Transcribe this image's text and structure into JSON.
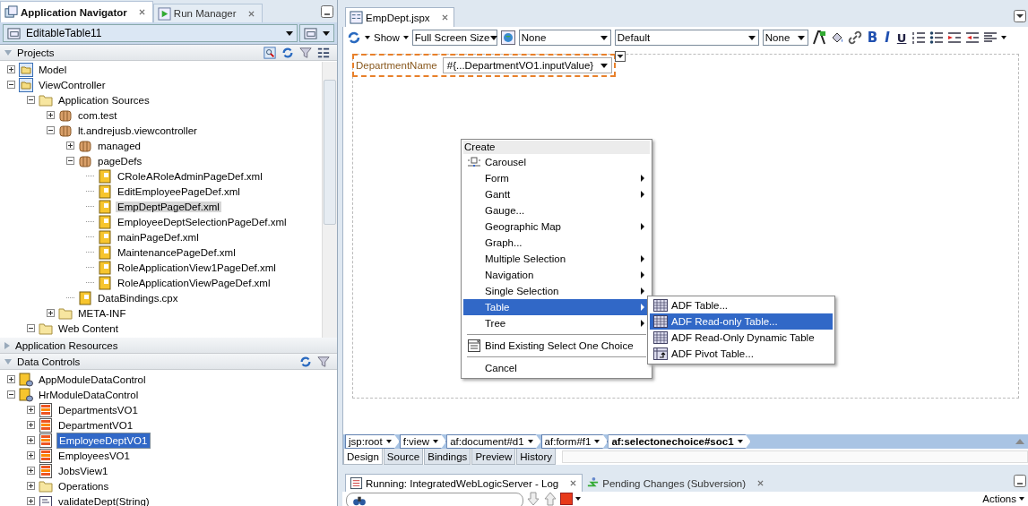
{
  "navigator": {
    "tabs": [
      {
        "label": "Application Navigator",
        "selected": true
      },
      {
        "label": "Run Manager",
        "selected": false
      }
    ],
    "application": "EditableTable11",
    "projects": {
      "title": "Projects",
      "expanded": true,
      "focused": false,
      "tree": [
        {
          "label": "Model",
          "kind": "project",
          "expanded": false,
          "selected": false
        },
        {
          "label": "ViewController",
          "kind": "project",
          "expanded": true,
          "selected": false,
          "children": [
            {
              "label": "Application Sources",
              "kind": "folder",
              "expanded": true,
              "selected": false,
              "children": [
                {
                  "label": "com.test",
                  "kind": "package",
                  "expanded": false,
                  "selected": false
                },
                {
                  "label": "lt.andrejusb.viewcontroller",
                  "kind": "package",
                  "expanded": true,
                  "selected": false,
                  "children": [
                    {
                      "label": "managed",
                      "kind": "package",
                      "expanded": false,
                      "selected": false
                    },
                    {
                      "label": "pageDefs",
                      "kind": "package",
                      "expanded": true,
                      "selected": false,
                      "children": [
                        {
                          "label": "CRoleARoleAdminPageDef.xml",
                          "kind": "pagedef",
                          "selected": false
                        },
                        {
                          "label": "EditEmployeePageDef.xml",
                          "kind": "pagedef",
                          "selected": false
                        },
                        {
                          "label": "EmpDeptPageDef.xml",
                          "kind": "pagedef",
                          "selected": true
                        },
                        {
                          "label": "EmployeeDeptSelectionPageDef.xml",
                          "kind": "pagedef",
                          "selected": false
                        },
                        {
                          "label": "mainPageDef.xml",
                          "kind": "pagedef",
                          "selected": false
                        },
                        {
                          "label": "MaintenancePageDef.xml",
                          "kind": "pagedef",
                          "selected": false
                        },
                        {
                          "label": "RoleApplicationView1PageDef.xml",
                          "kind": "pagedef",
                          "selected": false
                        },
                        {
                          "label": "RoleApplicationViewPageDef.xml",
                          "kind": "pagedef",
                          "selected": false
                        }
                      ]
                    },
                    {
                      "label": "DataBindings.cpx",
                      "kind": "pagedef",
                      "selected": false
                    }
                  ]
                },
                {
                  "label": "META-INF",
                  "kind": "folder",
                  "expanded": false,
                  "selected": false
                }
              ]
            },
            {
              "label": "Web Content",
              "kind": "folder",
              "expanded": true,
              "selected": false
            }
          ]
        }
      ]
    },
    "resources": {
      "title": "Application Resources",
      "expanded": false
    },
    "data_controls": {
      "title": "Data Controls",
      "expanded": true,
      "focused": true,
      "tree": [
        {
          "label": "AppModuleDataControl",
          "kind": "datacontrol",
          "expanded": false,
          "selected": false
        },
        {
          "label": "HrModuleDataControl",
          "kind": "datacontrol",
          "expanded": true,
          "selected": false,
          "children": [
            {
              "label": "DepartmentsVO1",
              "kind": "collection",
              "expanded": false,
              "selected": false
            },
            {
              "label": "DepartmentVO1",
              "kind": "collection",
              "expanded": false,
              "selected": false
            },
            {
              "label": "EmployeeDeptVO1",
              "kind": "collection",
              "expanded": false,
              "selected": true
            },
            {
              "label": "EmployeesVO1",
              "kind": "collection",
              "expanded": false,
              "selected": false
            },
            {
              "label": "JobsView1",
              "kind": "collection",
              "expanded": false,
              "selected": false
            },
            {
              "label": "Operations",
              "kind": "folder",
              "expanded": false,
              "selected": false
            },
            {
              "label": "validateDept(String)",
              "kind": "method",
              "expanded": false,
              "selected": false
            }
          ]
        }
      ]
    }
  },
  "editor": {
    "tab": {
      "label": "EmpDept.jspx"
    },
    "toolbar": {
      "show": "Show",
      "size": "Full Screen Size",
      "selects": [
        "None",
        "Default",
        "None"
      ],
      "format_buttons": [
        "B",
        "I",
        "U"
      ]
    },
    "form": {
      "label": "DepartmentName",
      "value": "#{...DepartmentVO1.inputValue}"
    },
    "context_menu": {
      "title": "Create",
      "items": [
        {
          "kind": "carousel",
          "label": "Carousel",
          "submenu": false,
          "selected": false
        },
        {
          "kind": "plain",
          "label": "Form",
          "submenu": true,
          "selected": false
        },
        {
          "kind": "plain",
          "label": "Gantt",
          "submenu": true,
          "selected": false
        },
        {
          "kind": "plain",
          "label": "Gauge...",
          "submenu": false,
          "selected": false
        },
        {
          "kind": "plain",
          "label": "Geographic Map",
          "submenu": true,
          "selected": false
        },
        {
          "kind": "plain",
          "label": "Graph...",
          "submenu": false,
          "selected": false
        },
        {
          "kind": "plain",
          "label": "Multiple Selection",
          "submenu": true,
          "selected": false
        },
        {
          "kind": "plain",
          "label": "Navigation",
          "submenu": true,
          "selected": false
        },
        {
          "kind": "plain",
          "label": "Single Selection",
          "submenu": true,
          "selected": false
        },
        {
          "kind": "plain",
          "label": "Table",
          "submenu": true,
          "selected": true
        },
        {
          "kind": "plain",
          "label": "Tree",
          "submenu": true,
          "selected": false
        },
        {
          "kind": "separator"
        },
        {
          "kind": "binding",
          "label": "Bind Existing Select One Choice",
          "submenu": false,
          "selected": false
        },
        {
          "kind": "separator"
        },
        {
          "kind": "plain",
          "label": "Cancel",
          "submenu": false,
          "selected": false
        }
      ]
    },
    "submenu": {
      "items": [
        {
          "kind": "table",
          "label": "ADF Table...",
          "selected": false
        },
        {
          "kind": "table",
          "label": "ADF Read-only Table...",
          "selected": true
        },
        {
          "kind": "table",
          "label": "ADF Read-Only Dynamic Table",
          "selected": false
        },
        {
          "kind": "pivot",
          "label": "ADF Pivot Table...",
          "selected": false
        }
      ]
    },
    "breadcrumb": [
      {
        "label": "jsp:root",
        "selected": false
      },
      {
        "label": "f:view",
        "selected": false
      },
      {
        "label": "af:document#d1",
        "selected": false
      },
      {
        "label": "af:form#f1",
        "selected": false
      },
      {
        "label": "af:selectonechoice#soc1",
        "selected": true
      }
    ],
    "view_tabs": [
      {
        "label": "Design",
        "selected": true
      },
      {
        "label": "Source",
        "selected": false
      },
      {
        "label": "Bindings",
        "selected": false
      },
      {
        "label": "Preview",
        "selected": false
      },
      {
        "label": "History",
        "selected": false
      }
    ]
  },
  "log": {
    "tabs": [
      {
        "label": "Running: IntegratedWebLogicServer - Log",
        "selected": true
      },
      {
        "label": "Pending Changes (Subversion)",
        "selected": false
      }
    ],
    "actions": "Actions"
  }
}
